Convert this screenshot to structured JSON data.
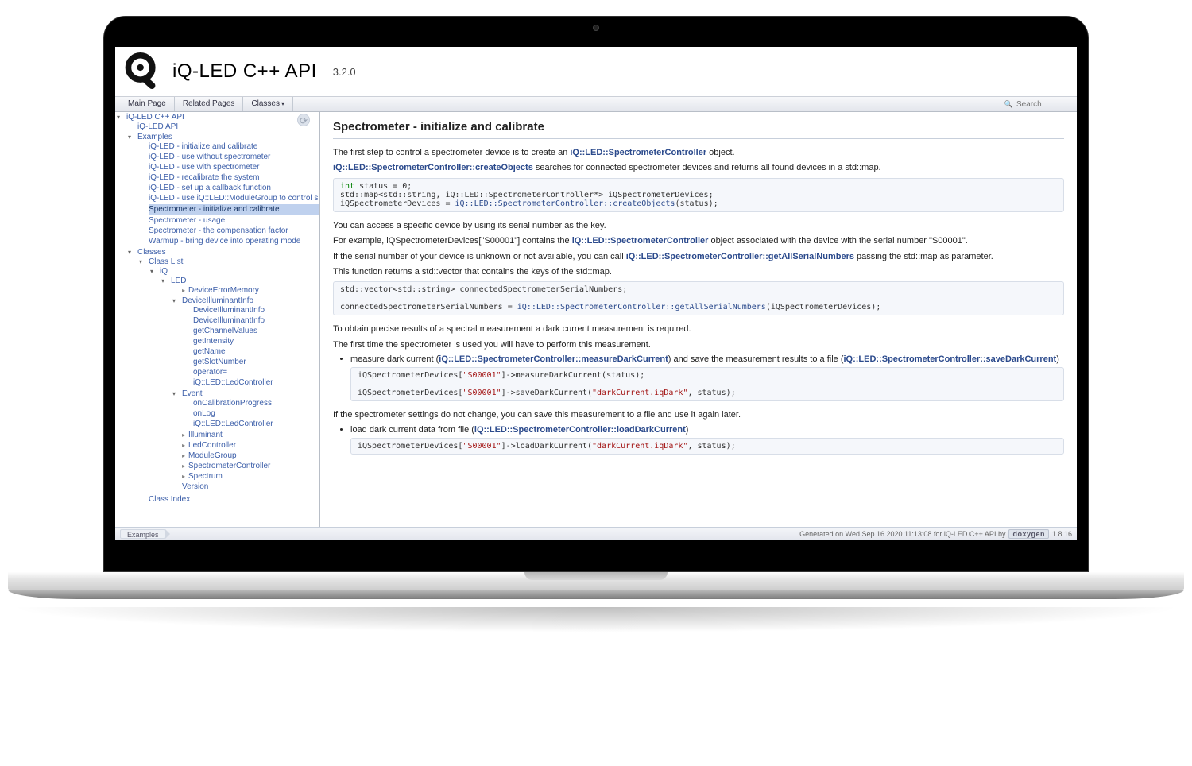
{
  "app": {
    "title": "iQ-LED C++ API",
    "version": "3.2.0"
  },
  "nav_tabs": {
    "main_page": "Main Page",
    "related_pages": "Related Pages",
    "classes": "Classes"
  },
  "search": {
    "placeholder": "Search",
    "icon_glyph": "🔍"
  },
  "sidebar": {
    "root": "iQ-LED C++ API",
    "api": "iQ-LED API",
    "examples_label": "Examples",
    "examples": [
      "iQ-LED - initialize and calibrate",
      "iQ-LED - use without spectrometer",
      "iQ-LED - use with spectrometer",
      "iQ-LED - recalibrate the system",
      "iQ-LED - set up a callback function",
      "iQ-LED - use iQ::LED::ModuleGroup to control single modules",
      "Spectrometer - initialize and calibrate",
      "Spectrometer - usage",
      "Spectrometer - the compensation factor",
      "Warmup - bring device into operating mode"
    ],
    "classes_label": "Classes",
    "class_list_label": "Class List",
    "ns_iq": "iQ",
    "ns_led": "LED",
    "dev_error_memory": "DeviceErrorMemory",
    "dev_illuminant_info": "DeviceIlluminantInfo",
    "members": [
      "DeviceIlluminantInfo",
      "DeviceIlluminantInfo",
      "getChannelValues",
      "getIntensity",
      "getName",
      "getSlotNumber",
      "operator=",
      "iQ::LED::LedController"
    ],
    "event_label": "Event",
    "event_members": [
      "onCalibrationProgress",
      "onLog",
      "iQ::LED::LedController"
    ],
    "tail": [
      "Illuminant",
      "LedController",
      "ModuleGroup",
      "SpectrometerController",
      "Spectrum",
      "Version"
    ],
    "class_index": "Class Index"
  },
  "page": {
    "title": "Spectrometer - initialize and calibrate",
    "p1_a": "The first step to control a spectrometer device is to create an ",
    "p1_link": "iQ::LED::SpectrometerController",
    "p1_b": " object.",
    "p2_link": "iQ::LED::SpectrometerController::createObjects",
    "p2_b": " searches for connected spectrometer devices and returns all found devices in a std::map.",
    "code1_l1_a": "int",
    "code1_l1_b": " status = 0;",
    "code1_l2": "std::map<std::string, iQ::LED::SpectrometerController*> iQSpectrometerDevices;",
    "code1_l3_a": "iQSpectrometerDevices = ",
    "code1_l3_link": "iQ::LED::SpectrometerController::createObjects",
    "code1_l3_b": "(status);",
    "p3": "You can access a specific device by using its serial number as the key.",
    "p4_a": "For example, iQSpectrometerDevices[\"S00001\"] contains the ",
    "p4_link": "iQ::LED::SpectrometerController",
    "p4_b": " object associated with the device with the serial number \"S00001\".",
    "p5_a": "If the serial number of your device is unknown or not available, you can call ",
    "p5_link": "iQ::LED::SpectrometerController::getAllSerialNumbers",
    "p5_b": " passing the std::map as parameter.",
    "p6": "This function returns a std::vector that contains the keys of the std::map.",
    "code2_l1": "std::vector<std::string> connectedSpectrometerSerialNumbers;",
    "code2_l2_a": "connectedSpectrometerSerialNumbers = ",
    "code2_l2_link": "iQ::LED::SpectrometerController::getAllSerialNumbers",
    "code2_l2_b": "(iQSpectrometerDevices);",
    "p7": "To obtain precise results of a spectral measurement a dark current measurement is required.",
    "p8": "The first time the spectrometer is used you will have to perform this measurement.",
    "li1_a": "measure dark current (",
    "li1_link1": "iQ::LED::SpectrometerController::measureDarkCurrent",
    "li1_b": ") and save the measurement results to a file (",
    "li1_link2": "iQ::LED::SpectrometerController::saveDarkCurrent",
    "li1_c": ")",
    "code3_l1_a": "iQSpectrometerDevices[",
    "code3_l1_s": "\"S00001\"",
    "code3_l1_b": "]->measureDarkCurrent(status);",
    "code3_l2_a": "iQSpectrometerDevices[",
    "code3_l2_s1": "\"S00001\"",
    "code3_l2_b": "]->saveDarkCurrent(",
    "code3_l2_s2": "\"darkCurrent.iqDark\"",
    "code3_l2_c": ", status);",
    "p9": "If the spectrometer settings do not change, you can save this measurement to a file and use it again later.",
    "li2_a": "load dark current data from file (",
    "li2_link": "iQ::LED::SpectrometerController::loadDarkCurrent",
    "li2_b": ")",
    "code4_a": "iQSpectrometerDevices[",
    "code4_s1": "\"S00001\"",
    "code4_b": "]->loadDarkCurrent(",
    "code4_s2": "\"darkCurrent.iqDark\"",
    "code4_c": ", status);"
  },
  "footer": {
    "crumb": "Examples",
    "generated": "Generated on Wed Sep 16 2020 11:13:08 for iQ-LED C++ API by",
    "doxygen": "doxygen",
    "version": "1.8.16"
  }
}
